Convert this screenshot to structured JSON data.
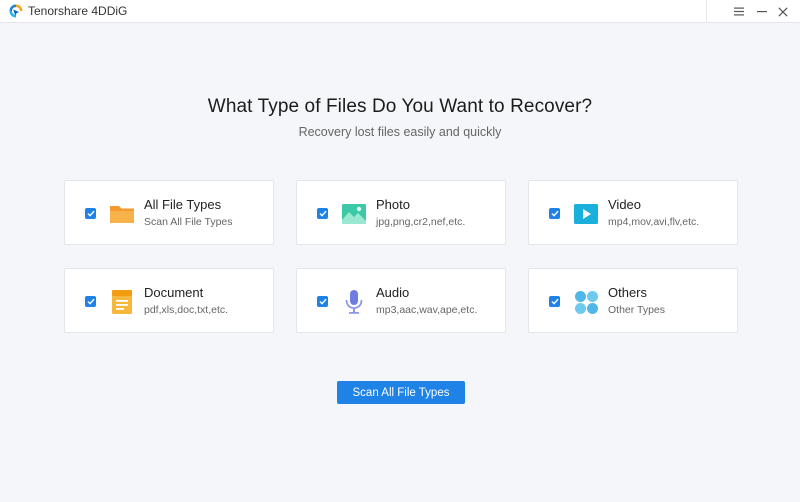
{
  "window": {
    "title": "Tenorshare 4DDiG",
    "logo_icon": "tenorshare-logo-icon",
    "controls": [
      "menu-icon",
      "minimize-icon",
      "close-icon"
    ]
  },
  "main": {
    "heading": "What Type of Files Do You Want to Recover?",
    "subheading": "Recovery lost files easily and quickly"
  },
  "file_types": [
    {
      "label": "All File Types",
      "desc": "Scan All File Types",
      "icon": "folder-icon",
      "checked": true
    },
    {
      "label": "Photo",
      "desc": "jpg,png,cr2,nef,etc.",
      "icon": "photo-icon",
      "checked": true
    },
    {
      "label": "Video",
      "desc": "mp4,mov,avi,flv,etc.",
      "icon": "video-icon",
      "checked": true
    },
    {
      "label": "Document",
      "desc": "pdf,xls,doc,txt,etc.",
      "icon": "document-icon",
      "checked": true
    },
    {
      "label": "Audio",
      "desc": "mp3,aac,wav,ape,etc.",
      "icon": "microphone-icon",
      "checked": true
    },
    {
      "label": "Others",
      "desc": "Other Types",
      "icon": "others-icon",
      "checked": true
    }
  ],
  "actions": {
    "scan_label": "Scan All File Types"
  },
  "colors": {
    "accent": "#1e82e6",
    "background": "#f4f6fa",
    "card": "#ffffff",
    "folder": "#f7a53a",
    "photo": "#3cc9a8",
    "video": "#1bb0dc",
    "document": "#f5b83c",
    "audio": "#6f7ce0",
    "others": "#4fb8e8"
  }
}
